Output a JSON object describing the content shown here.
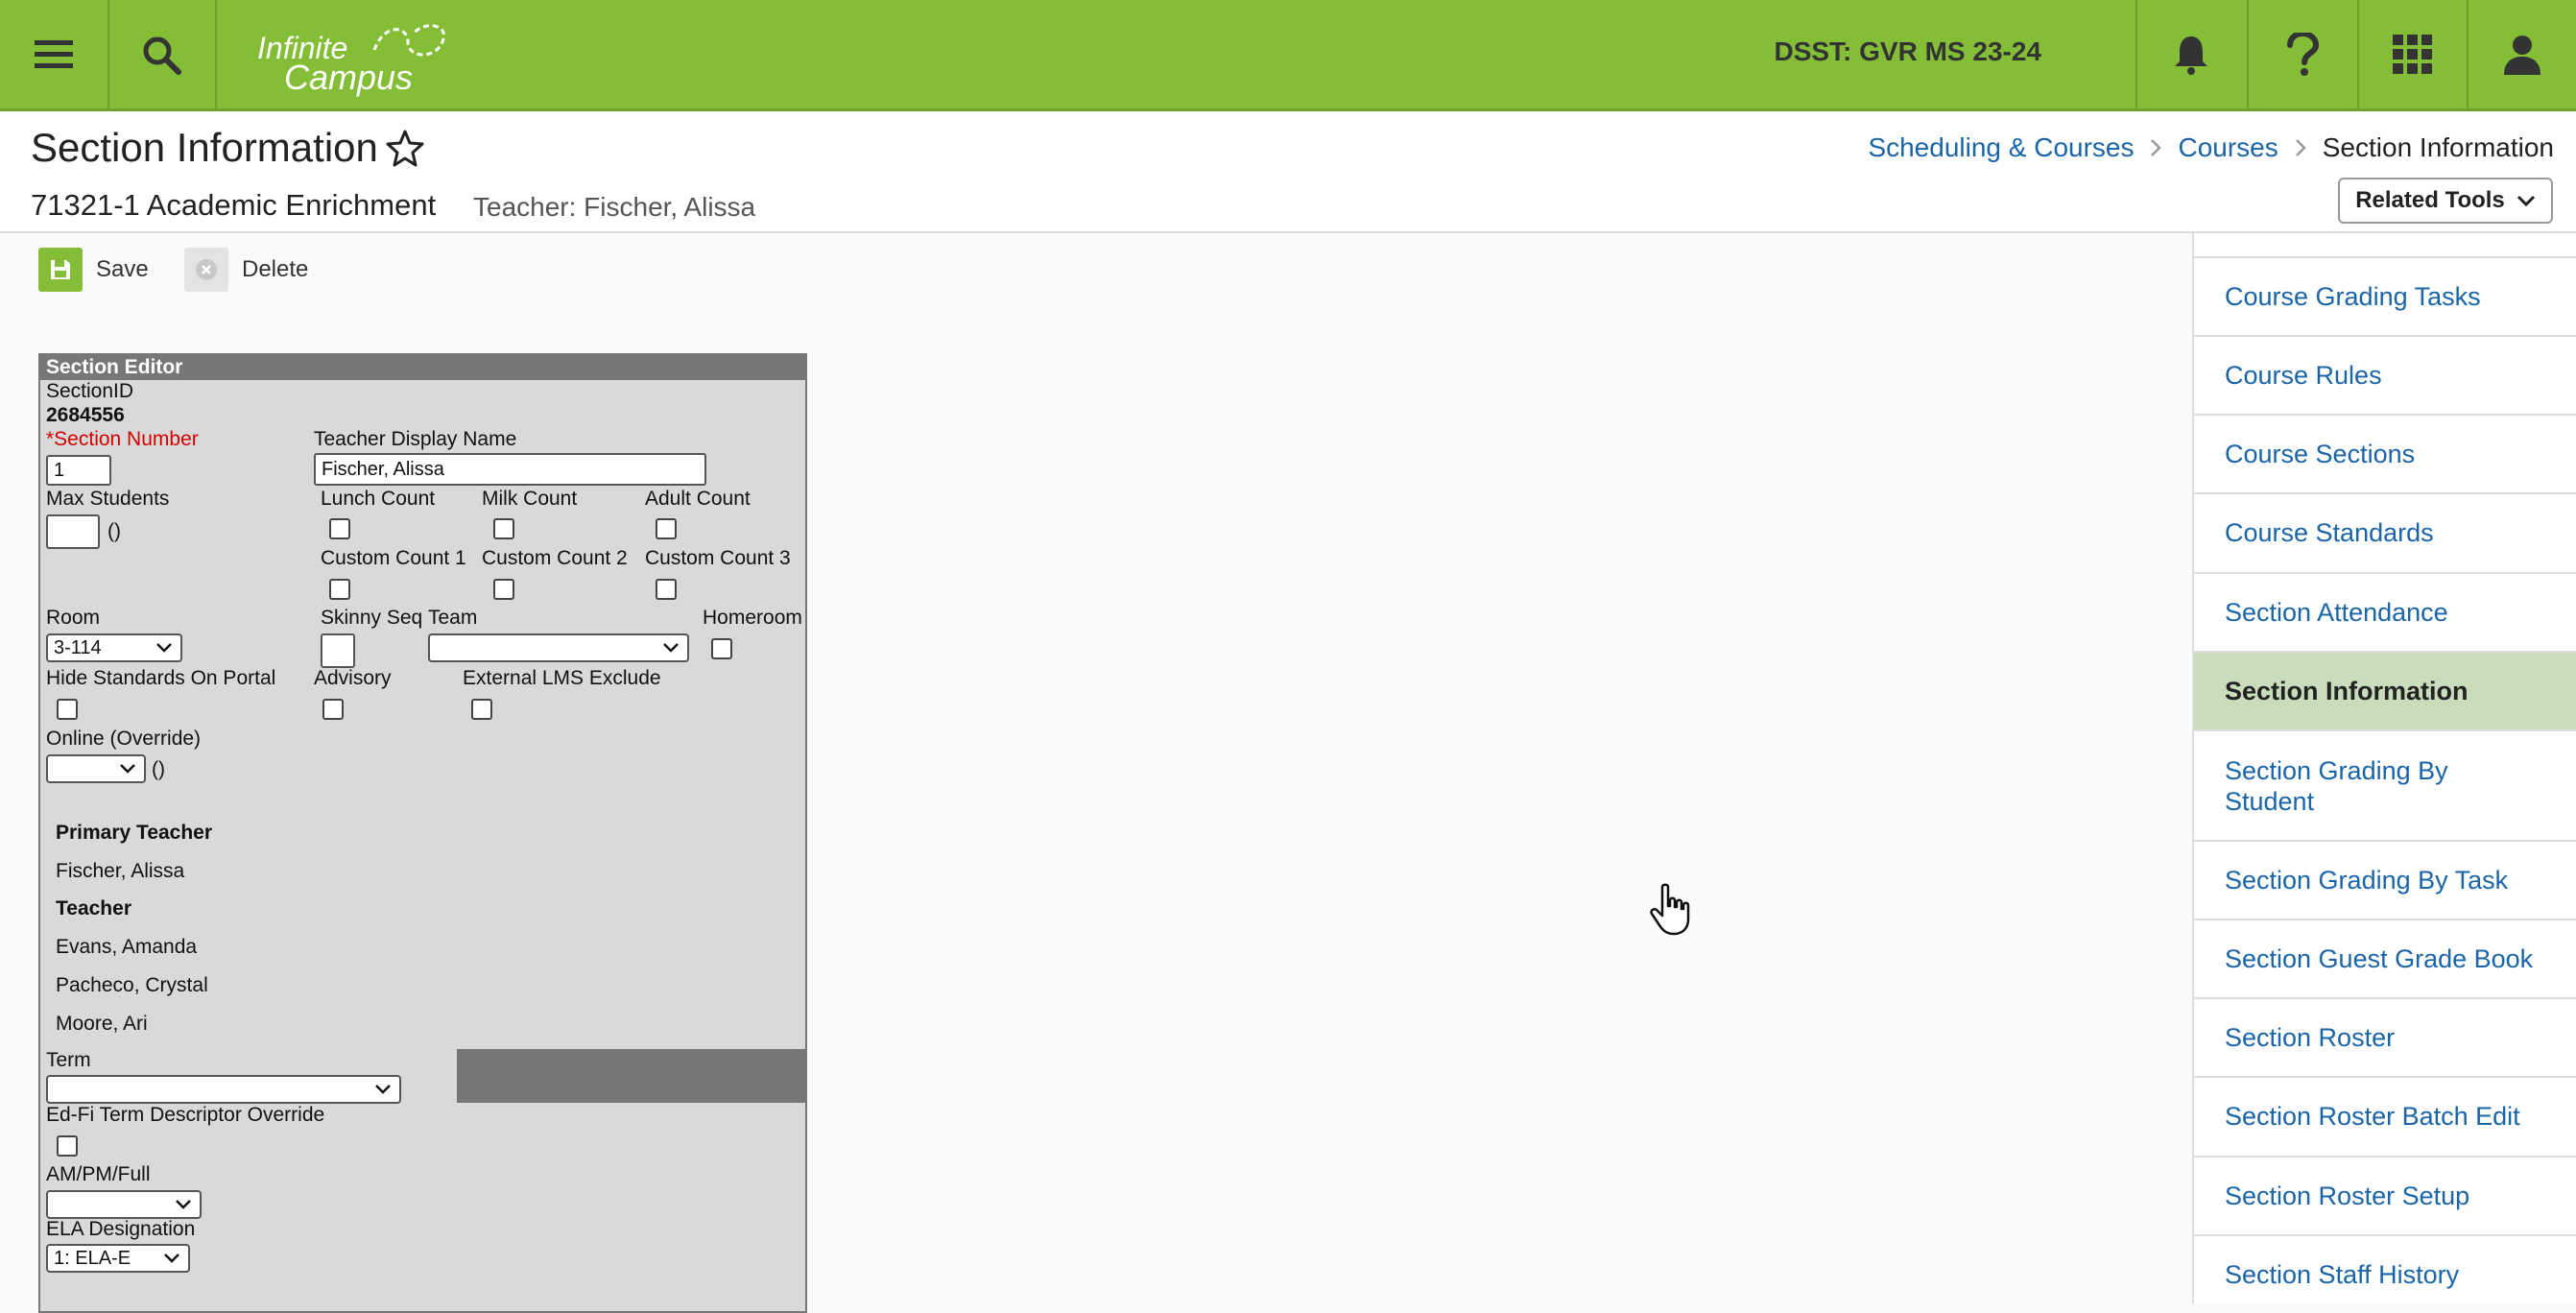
{
  "topbar": {
    "logo_line1": "Infinite",
    "logo_line2": "Campus",
    "school": "DSST: GVR MS 23-24"
  },
  "header": {
    "title": "Section Information",
    "subtitle": "71321-1 Academic Enrichment",
    "teacher": "Teacher: Fischer, Alissa",
    "breadcrumbs": [
      "Scheduling & Courses",
      "Courses",
      "Section Information"
    ],
    "related_tools": "Related Tools"
  },
  "toolbar": {
    "save": "Save",
    "delete": "Delete"
  },
  "editor": {
    "heading": "Section Editor",
    "section_id_label": "SectionID",
    "section_id": "2684556",
    "section_number_label": "*Section Number",
    "section_number": "1",
    "teacher_display_label": "Teacher Display Name",
    "teacher_display": "Fischer, Alissa",
    "max_students_label": "Max Students",
    "max_students_suffix": "()",
    "lunch_count": "Lunch Count",
    "milk_count": "Milk Count",
    "adult_count": "Adult Count",
    "custom_count_1": "Custom Count 1",
    "custom_count_2": "Custom Count 2",
    "custom_count_3": "Custom Count 3",
    "room_label": "Room",
    "room_value": "3-114",
    "skinny_label": "Skinny Seq",
    "team_label": "Team",
    "homeroom_label": "Homeroom",
    "hide_standards_label": "Hide Standards On Portal",
    "advisory_label": "Advisory",
    "external_lms_label": "External LMS Exclude",
    "online_label": "Online (Override)",
    "online_suffix": "()",
    "primary_teacher_heading": "Primary Teacher",
    "primary_teacher": "Fischer, Alissa",
    "teacher_heading": "Teacher",
    "teachers": [
      "Evans, Amanda",
      "Pacheco, Crystal",
      "Moore, Ari"
    ],
    "term_label": "Term",
    "edfi_label": "Ed-Fi Term Descriptor Override",
    "ampm_label": "AM/PM/Full",
    "ela_label": "ELA Designation",
    "ela_value": "1: ELA-E"
  },
  "related_menu": [
    "Course Grading Tasks",
    "Course Rules",
    "Course Sections",
    "Course Standards",
    "Section Attendance",
    "Section Information",
    "Section Grading By Student",
    "Section Grading By Task",
    "Section Guest Grade Book",
    "Section Roster",
    "Section Roster Batch Edit",
    "Section Roster Setup",
    "Section Staff History"
  ],
  "colors": {
    "brand": "#84bd36",
    "link": "#1a64a8",
    "active_bg": "#c9dcbc"
  }
}
